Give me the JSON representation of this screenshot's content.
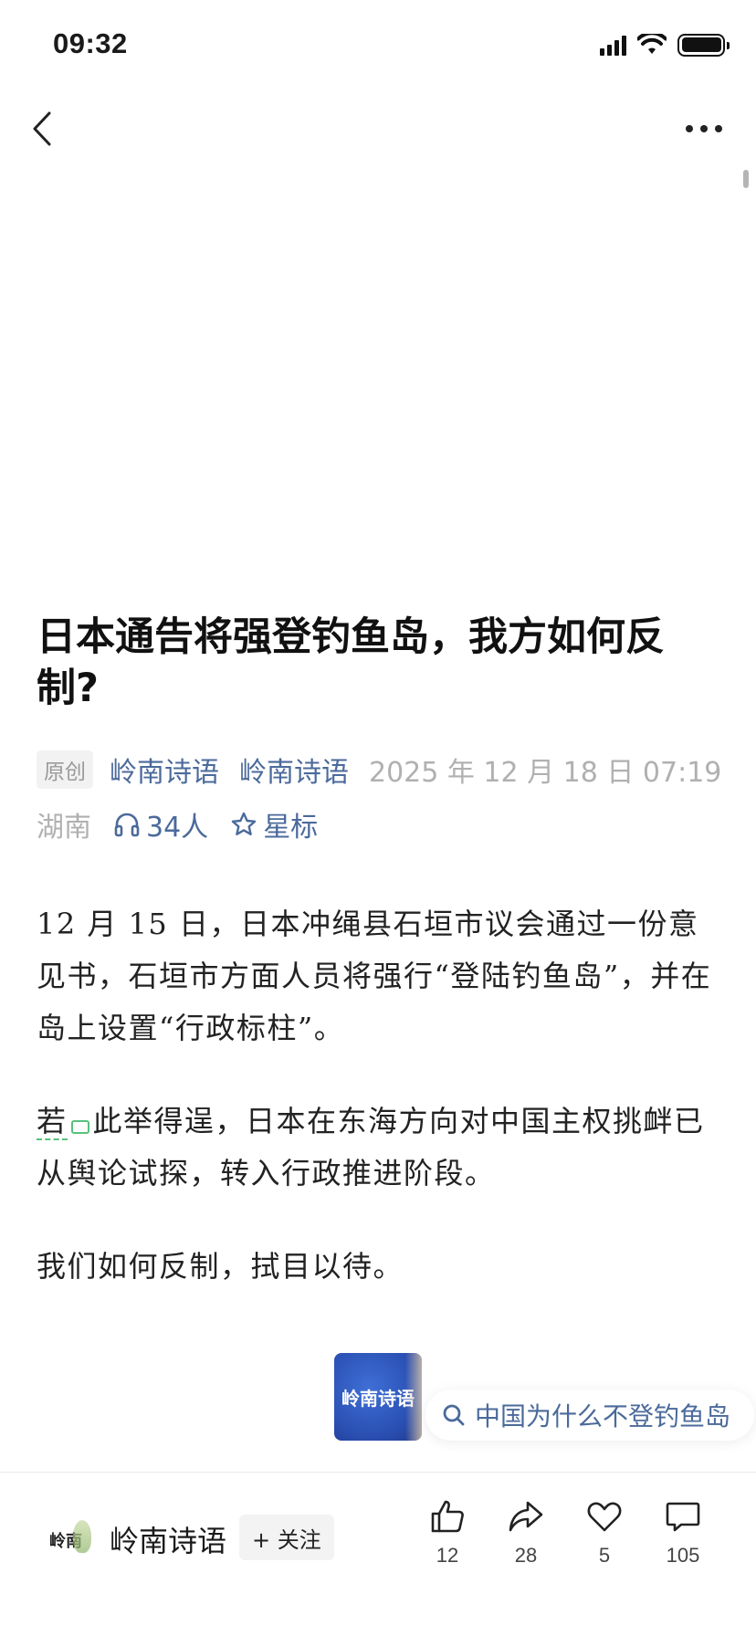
{
  "status_bar": {
    "time": "09:32",
    "battery_level": 1.0
  },
  "nav": {
    "back_icon": "chevron-left-icon",
    "more_icon": "more-horizontal-icon"
  },
  "article": {
    "title": "日本通告将强登钓鱼岛，我方如何反制?",
    "tag": "原创",
    "author_link_1": "岭南诗语",
    "author_link_2": "岭南诗语",
    "date": "2025 年 12 月 18 日 07:19",
    "location": "湖南",
    "listen_count": "34人",
    "star_label": "星标",
    "paragraphs": [
      "12 月 15 日，日本冲绳县石垣市议会通过一份意见书，石垣市方面人员将强行“登陆钓鱼岛”，并在岛上设置“行政标柱”。",
      {
        "annotated_word": "若",
        "rest": "此举得逞，日本在东海方向对中国主权挑衅已从舆论试探，转入行政推进阶段。"
      },
      "我们如何反制，拭目以待。"
    ]
  },
  "account_card": {
    "logo_text": "岭南诗语",
    "search_suggestion": "中国为什么不登钓鱼岛"
  },
  "bottom_bar": {
    "author_name": "岭南诗语",
    "avatar_text": "岭南",
    "follow_label": "+ 关注",
    "like_count": "12",
    "share_count": "28",
    "favorite_count": "5",
    "comment_count": "105"
  },
  "colors": {
    "link": "#4b6a9b",
    "muted": "#b0b0b0",
    "annotation": "#57c17b"
  }
}
